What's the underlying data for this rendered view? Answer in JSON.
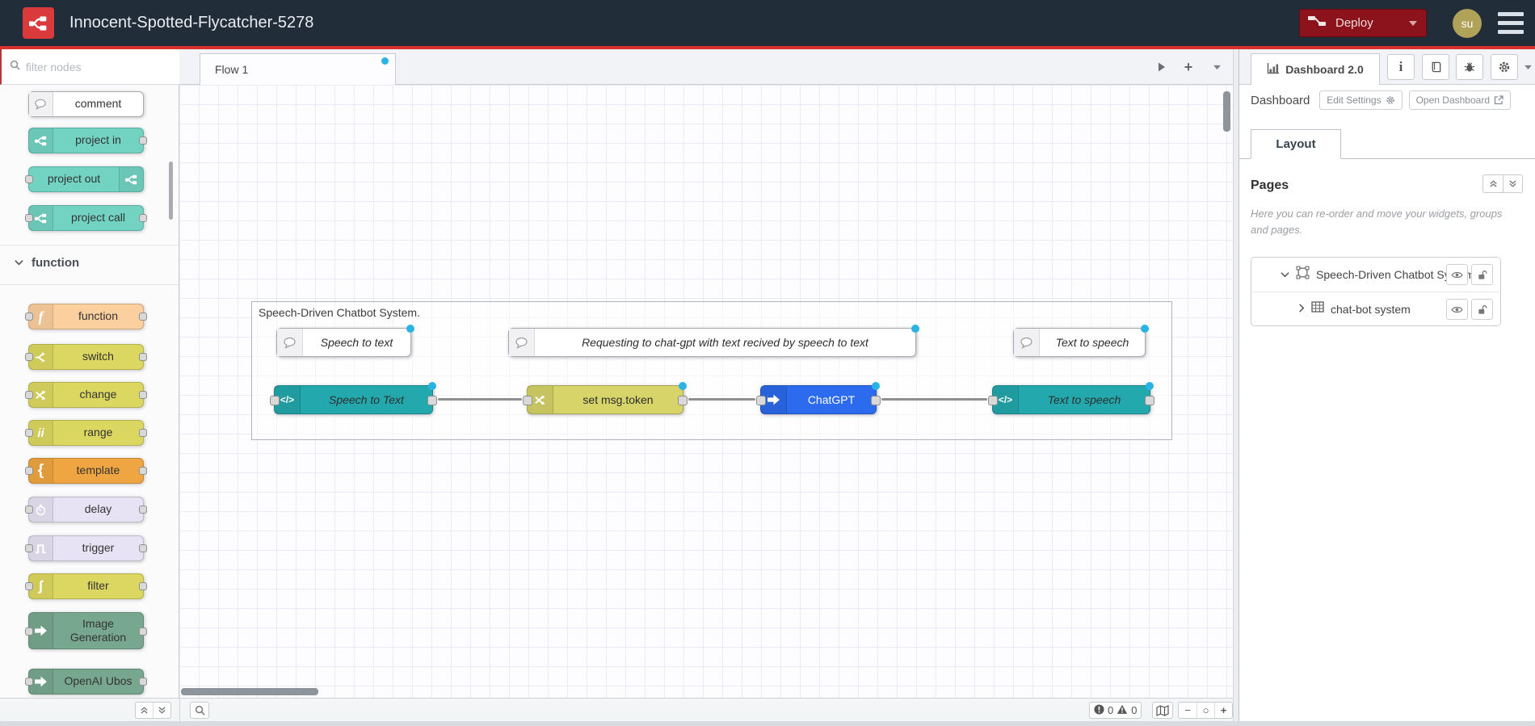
{
  "header": {
    "title": "Innocent-Spotted-Flycatcher-5278",
    "deploy": {
      "label": "Deploy"
    },
    "avatar": "su"
  },
  "palette": {
    "search_placeholder": "filter nodes",
    "category": "function",
    "nodes": {
      "comment": "comment",
      "project_in": "project in",
      "project_out": "project out",
      "project_call": "project call",
      "function": "function",
      "switch": "switch",
      "change": "change",
      "range": "range",
      "template": "template",
      "delay": "delay",
      "trigger": "trigger",
      "filter": "filter",
      "image_generation": "Image Generation",
      "openai_ubos": "OpenAI Ubos"
    }
  },
  "workspace": {
    "tab": "Flow 1",
    "group_label": "Speech-Driven Chatbot System.",
    "comments": {
      "c1": "Speech to text",
      "c2": "Requesting to chat-gpt with text recived by speech to text",
      "c3": "Text to speech"
    },
    "nodes": {
      "speech_to_text": "Speech to Text",
      "set_token": "set msg.token",
      "chatgpt": "ChatGPT",
      "text_to_speech": "Text to speech"
    },
    "footer": {
      "error_count": "0",
      "warning_count": "0"
    }
  },
  "sidebar": {
    "tab": "Dashboard 2.0",
    "section_title": "Dashboard",
    "edit_settings": "Edit Settings",
    "open_dashboard": "Open Dashboard",
    "layout_tab": "Layout",
    "pages_title": "Pages",
    "pages_description": "Here you can re-order and move your widgets, groups and pages.",
    "tree": {
      "page": "Speech-Driven Chatbot System",
      "group": "chat-bot system"
    }
  },
  "glyphs": {
    "code": "</>",
    "function_f": "f",
    "template_brace": "{",
    "filter_s": "∫",
    "range_ii": "ii",
    "zoom_out": "−",
    "zoom_reset": "○",
    "zoom_in": "+",
    "add_flow": "+",
    "info_i": "i"
  },
  "colors": {
    "header_bg": "#222d3a",
    "accent_red": "#d92f2f",
    "deploy_bg": "#8c121c",
    "palette_teal": "#72d3c3",
    "canvas_teal": "#23a9ad",
    "canvas_yellow": "#d7d46a",
    "canvas_blue": "#2c6bee",
    "changed_dot": "#2bb3e6"
  }
}
